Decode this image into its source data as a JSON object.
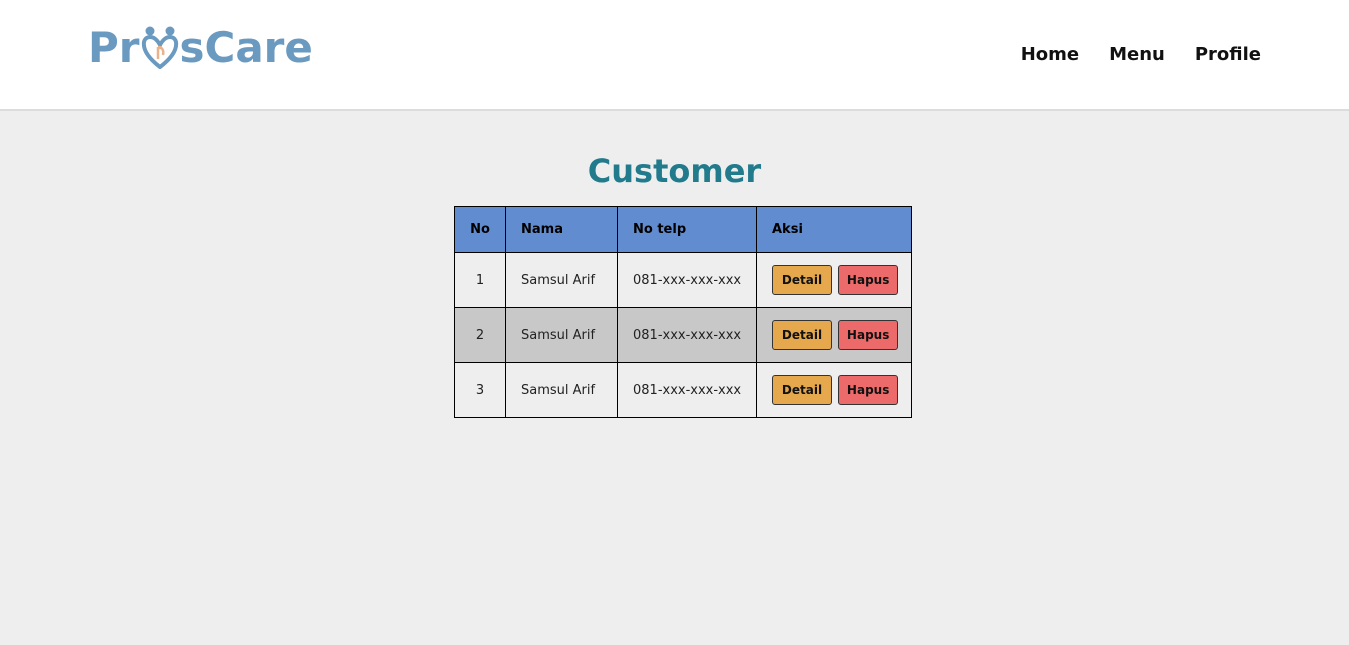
{
  "brand": {
    "part1": "Pr",
    "part2": "sCare",
    "color": "#6b9ac1"
  },
  "nav": {
    "items": [
      {
        "label": "Home"
      },
      {
        "label": "Menu"
      },
      {
        "label": "Profile"
      }
    ]
  },
  "page": {
    "title": "Customer",
    "title_color": "#217b8c"
  },
  "table": {
    "headers": {
      "no": "No",
      "nama": "Nama",
      "telp": "No telp",
      "aksi": "Aksi"
    },
    "header_color": "#628cd0",
    "rows": [
      {
        "no": "1",
        "nama": "Samsul Arif",
        "telp": "081-xxx-xxx-xxx"
      },
      {
        "no": "2",
        "nama": "Samsul Arif",
        "telp": "081-xxx-xxx-xxx"
      },
      {
        "no": "3",
        "nama": "Samsul Arif",
        "telp": "081-xxx-xxx-xxx"
      }
    ],
    "actions": {
      "detail": "Detail",
      "hapus": "Hapus"
    },
    "detail_color": "#e6a84c",
    "hapus_color": "#ed6a6a"
  }
}
